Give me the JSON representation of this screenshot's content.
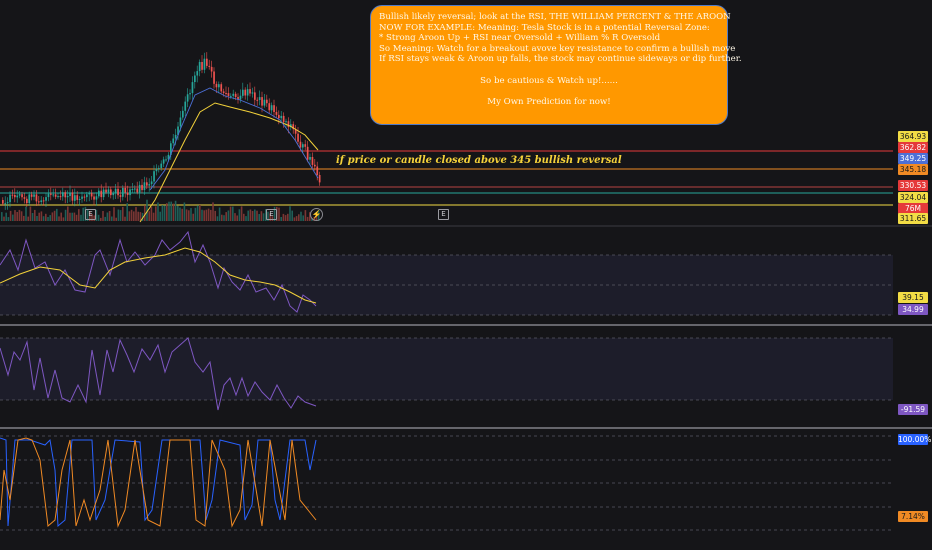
{
  "note": {
    "lines": [
      "Bullish likely reversal; look at the RSI, THE WILLIAM PERCENT & THE AROON",
      "NOW FOR EXAMPLE: Meaning: Tesla Stock is in a potential Reversal Zone:",
      "",
      "* Strong Aroon Up + RSI near Oversold + William % R Oversold",
      "So Meaning: Watch for a breakout avove key resistance to confirm a bullish move",
      "If RSI stays weak & Aroon up falls, the stock may continue sideways or dip further."
    ],
    "line_caution": "So be cautious & Watch up!......",
    "line_prediction": "My Own Prediction for now!"
  },
  "annotation": "if price or candle closed above 345 bullish reversal",
  "price_labels": [
    {
      "text": "364.93",
      "bg": "#f2dc45",
      "fg": "#1a1a1a"
    },
    {
      "text": "362.82",
      "bg": "#e5393a",
      "fg": "#ffffff"
    },
    {
      "text": "349.25",
      "bg": "#4c6fd6",
      "fg": "#ffffff"
    },
    {
      "text": "345.18",
      "bg": "#f08a24",
      "fg": "#1a1a1a"
    },
    {
      "text": "330.53",
      "bg": "#e5393a",
      "fg": "#ffffff"
    },
    {
      "text": "324.04",
      "bg": "#f2dc45",
      "fg": "#1a1a1a"
    },
    {
      "text": "76M",
      "bg": "#e5393a",
      "fg": "#ffffff"
    },
    {
      "text": "311.65",
      "bg": "#f2dc45",
      "fg": "#1a1a1a"
    }
  ],
  "rsi_labels": [
    {
      "text": "39.15",
      "bg": "#f2dc45",
      "fg": "#1a1a1a"
    },
    {
      "text": "34.99",
      "bg": "#7e57c2",
      "fg": "#ffffff"
    }
  ],
  "willr_label": {
    "text": "-91.59",
    "bg": "#7e57c2",
    "fg": "#ffffff"
  },
  "aroon_labels": [
    {
      "text": "100.00%",
      "bg": "#2962ff",
      "fg": "#ffffff"
    },
    {
      "text": "7.14%",
      "bg": "#f08a24",
      "fg": "#1a1a1a"
    }
  ],
  "event_marks": [
    "E",
    "E",
    "E"
  ],
  "colors": {
    "bull": "#26a69a",
    "bear": "#ef5350",
    "ma": "#f2d13a",
    "rsi": "#7e57c2",
    "willr": "#7e57c2",
    "aroon_up": "#2962ff",
    "aroon_down": "#f08a24",
    "res_red": "#e5393a",
    "res_orange": "#f08a24",
    "sup_yellow": "#f2dc45",
    "sup_green": "#26a69a"
  },
  "icons": {
    "lightning": "lightning-icon"
  }
}
